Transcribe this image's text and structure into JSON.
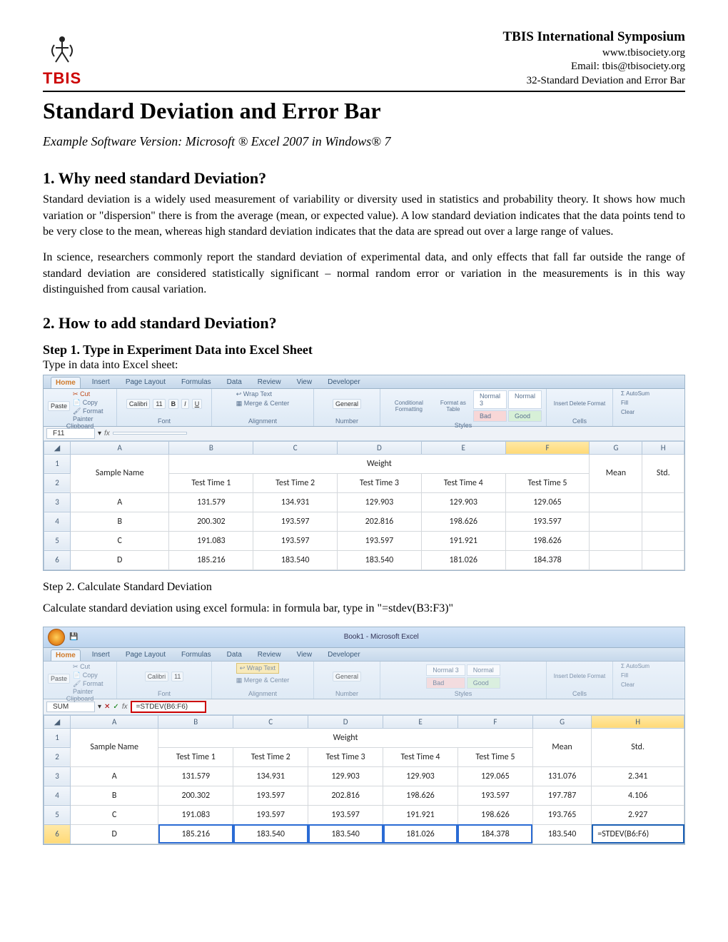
{
  "header": {
    "logo_text": "TBIS",
    "symposium": "TBIS International Symposium",
    "website": "www.tbisociety.org",
    "email": "Email: tbis@tbisociety.org",
    "doc_ref": "32-Standard Deviation and Error Bar"
  },
  "title": "Standard Deviation and Error Bar",
  "example_line": "Example Software Version: Microsoft ® Excel 2007 in Windows® 7",
  "section1_heading": "1.  Why need standard Deviation?",
  "section1_p1": "Standard deviation is a widely used measurement of variability or diversity used in statistics and probability theory. It shows how much variation or \"dispersion\" there is from the average (mean, or expected value). A low standard deviation indicates that the data points tend to be very close to the mean, whereas high standard deviation indicates that the data are spread out over a large range of values.",
  "section1_p2": "In science, researchers commonly report the standard deviation of experimental data, and only effects that fall far outside the range of standard deviation are considered statistically significant – normal random error or variation in the measurements is in this way distinguished from causal variation.",
  "section2_heading": "2.  How to add standard Deviation?",
  "step1_heading": "Step 1. Type in Experiment Data into Excel Sheet",
  "step1_line": "Type in data into Excel sheet:",
  "step2_heading": "Step 2. Calculate Standard Deviation",
  "step2_line": "Calculate standard deviation using excel formula: in formula bar, type in \"=stdev(B3:F3)\"",
  "ribbon": {
    "tabs": [
      "Home",
      "Insert",
      "Page Layout",
      "Formulas",
      "Data",
      "Review",
      "View",
      "Developer"
    ],
    "active_tab": "Home",
    "clipboard": {
      "cut": "Cut",
      "copy": "Copy",
      "paste": "Paste",
      "fmtpaint": "Format Painter",
      "label": "Clipboard"
    },
    "font": {
      "name": "Calibri",
      "size": "11",
      "label": "Font"
    },
    "alignment": {
      "wrap": "Wrap Text",
      "merge": "Merge & Center",
      "label": "Alignment"
    },
    "number": {
      "fmt": "General",
      "label": "Number"
    },
    "styles": {
      "cond": "Conditional Formatting",
      "fmt_table": "Format as Table",
      "normal3": "Normal 3",
      "normal": "Normal",
      "bad": "Bad",
      "good": "Good",
      "label": "Styles"
    },
    "cells": {
      "insert": "Insert",
      "delete": "Delete",
      "format": "Format",
      "label": "Cells"
    },
    "editing": {
      "autosum": "Σ AutoSum",
      "fill": "Fill",
      "clear": "Clear"
    }
  },
  "sheet1": {
    "name_box": "F11",
    "formula": "",
    "cols": [
      "A",
      "B",
      "C",
      "D",
      "E",
      "F",
      "G",
      "H"
    ],
    "r1": {
      "sample": "Sample Name",
      "weight": "Weight",
      "mean": "Mean",
      "std": "Std."
    },
    "r2": [
      "Test Time 1",
      "Test Time 2",
      "Test Time 3",
      "Test Time 4",
      "Test Time 5"
    ],
    "rows": [
      {
        "n": "A",
        "v": [
          "131.579",
          "134.931",
          "129.903",
          "129.903",
          "129.065"
        ],
        "mean": "",
        "std": ""
      },
      {
        "n": "B",
        "v": [
          "200.302",
          "193.597",
          "202.816",
          "198.626",
          "193.597"
        ],
        "mean": "",
        "std": ""
      },
      {
        "n": "C",
        "v": [
          "191.083",
          "193.597",
          "193.597",
          "191.921",
          "198.626"
        ],
        "mean": "",
        "std": ""
      },
      {
        "n": "D",
        "v": [
          "185.216",
          "183.540",
          "183.540",
          "181.026",
          "184.378"
        ],
        "mean": "",
        "std": ""
      }
    ]
  },
  "sheet2": {
    "window_title": "Book1 - Microsoft Excel",
    "name_box": "SUM",
    "formula": "=STDEV(B6:F6)",
    "cols": [
      "A",
      "B",
      "C",
      "D",
      "E",
      "F",
      "G",
      "H"
    ],
    "r1": {
      "sample": "Sample Name",
      "weight": "Weight",
      "mean": "Mean",
      "std": "Std."
    },
    "r2": [
      "Test Time 1",
      "Test Time 2",
      "Test Time 3",
      "Test Time 4",
      "Test Time 5"
    ],
    "rows": [
      {
        "n": "A",
        "v": [
          "131.579",
          "134.931",
          "129.903",
          "129.903",
          "129.065"
        ],
        "mean": "131.076",
        "std": "2.341"
      },
      {
        "n": "B",
        "v": [
          "200.302",
          "193.597",
          "202.816",
          "198.626",
          "193.597"
        ],
        "mean": "197.787",
        "std": "4.106"
      },
      {
        "n": "C",
        "v": [
          "191.083",
          "193.597",
          "193.597",
          "191.921",
          "198.626"
        ],
        "mean": "193.765",
        "std": "2.927"
      },
      {
        "n": "D",
        "v": [
          "185.216",
          "183.540",
          "183.540",
          "181.026",
          "184.378"
        ],
        "mean": "183.540",
        "std": "=STDEV(B6:F6)"
      }
    ]
  }
}
